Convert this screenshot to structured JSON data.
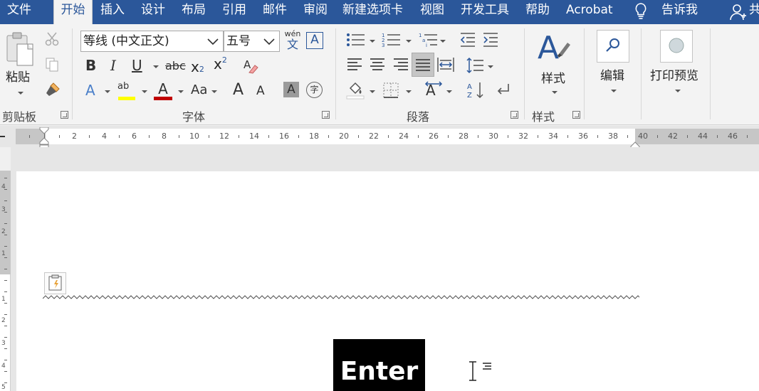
{
  "tabs": [
    {
      "label": "文件"
    },
    {
      "label": "开始",
      "active": true
    },
    {
      "label": "插入"
    },
    {
      "label": "设计"
    },
    {
      "label": "布局"
    },
    {
      "label": "引用"
    },
    {
      "label": "邮件"
    },
    {
      "label": "审阅"
    },
    {
      "label": "新建选项卡"
    },
    {
      "label": "视图"
    },
    {
      "label": "开发工具"
    },
    {
      "label": "帮助"
    },
    {
      "label": "Acrobat"
    },
    {
      "label": "告诉我"
    },
    {
      "label": "共"
    }
  ],
  "ribbon": {
    "clipboard": {
      "group_label": "剪贴板",
      "paste_label": "粘贴"
    },
    "font": {
      "group_label": "字体",
      "font_name": "等线 (中文正文)",
      "font_size": "五号",
      "phonetic_top": "wén",
      "phonetic_bottom": "文",
      "border_char": "A",
      "bold": "B",
      "italic": "I",
      "underline": "U",
      "strike": "abc",
      "sub_main": "x",
      "sub_idx": "2",
      "sup_main": "x",
      "sup_idx": "2",
      "effects": "A",
      "highlight": "ab",
      "font_color": "A",
      "change_case": "Aa",
      "grow": "A",
      "shrink": "A",
      "shading": "A",
      "enclose": "字"
    },
    "paragraph": {
      "group_label": "段落"
    },
    "styles": {
      "group_label": "样式",
      "button_label": "样式"
    },
    "editing": {
      "button_label": "编辑"
    },
    "print_preview": {
      "button_label": "打印预览"
    }
  },
  "ruler": {
    "h_numbers": [
      "2",
      "4",
      "6",
      "8",
      "10",
      "12",
      "14",
      "16",
      "18",
      "20",
      "22",
      "24",
      "26",
      "28",
      "30",
      "32",
      "34",
      "36",
      "38",
      "40",
      "42",
      "44",
      "46",
      "4"
    ],
    "v_numbers": [
      "4",
      "3",
      "2",
      "1",
      "1",
      "2",
      "3",
      "4",
      "5"
    ]
  },
  "document": {
    "key_label": "Enter"
  },
  "colors": {
    "ribbon_blue": "#2b579a",
    "highlight_yellow": "#ffff00",
    "font_color_red": "#c00000"
  }
}
